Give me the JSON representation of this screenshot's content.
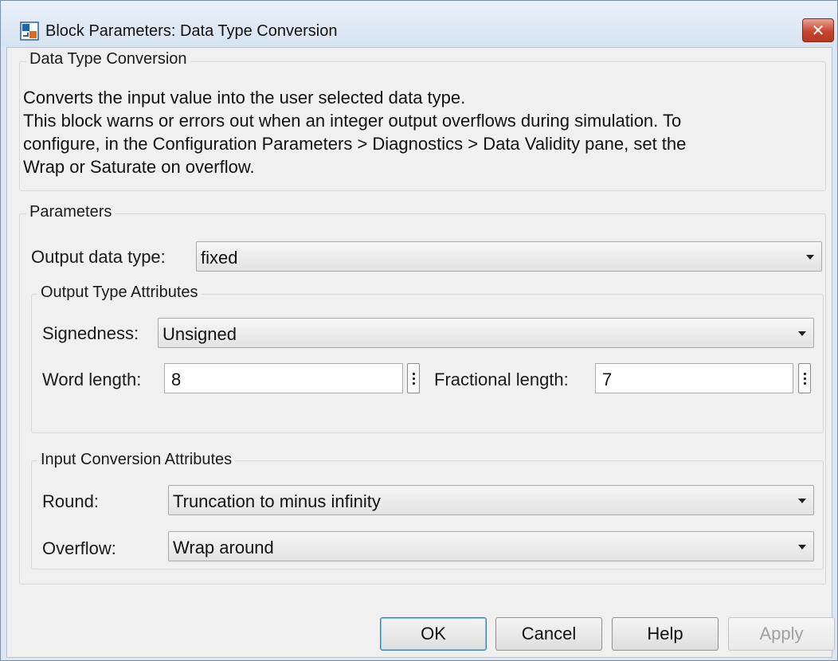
{
  "window": {
    "title": "Block Parameters: Data Type Conversion",
    "close_symbol": "✕",
    "accent_color": "#c8452d"
  },
  "block_group": {
    "title": "Data Type Conversion",
    "description": [
      "Converts the input value into the user selected data type.",
      "This block warns or errors out when an integer output overflows during simulation. To",
      "configure, in the Configuration Parameters > Diagnostics > Data Validity pane, set the",
      "Wrap or Saturate on overflow."
    ]
  },
  "parameters": {
    "title": "Parameters",
    "output_data_type": {
      "label": "Output data type:",
      "value": "fixed"
    },
    "output_type_attributes": {
      "title": "Output Type Attributes",
      "signedness": {
        "label": "Signedness:",
        "value": "Unsigned"
      },
      "word_length": {
        "label": "Word length:",
        "value": "8"
      },
      "fractional_length": {
        "label": "Fractional length:",
        "value": "7"
      }
    },
    "input_conversion_attributes": {
      "title": "Input Conversion Attributes",
      "round": {
        "label": "Round:",
        "value": "Truncation to minus infinity"
      },
      "overflow": {
        "label": "Overflow:",
        "value": "Wrap around"
      }
    }
  },
  "buttons": {
    "ok": "OK",
    "cancel": "Cancel",
    "help": "Help",
    "apply": "Apply"
  },
  "icons": {
    "app": "simulink-block-icon",
    "close": "close-icon",
    "dropdown": "chevron-down-icon",
    "stepper": "vertical-ellipsis-icon"
  }
}
